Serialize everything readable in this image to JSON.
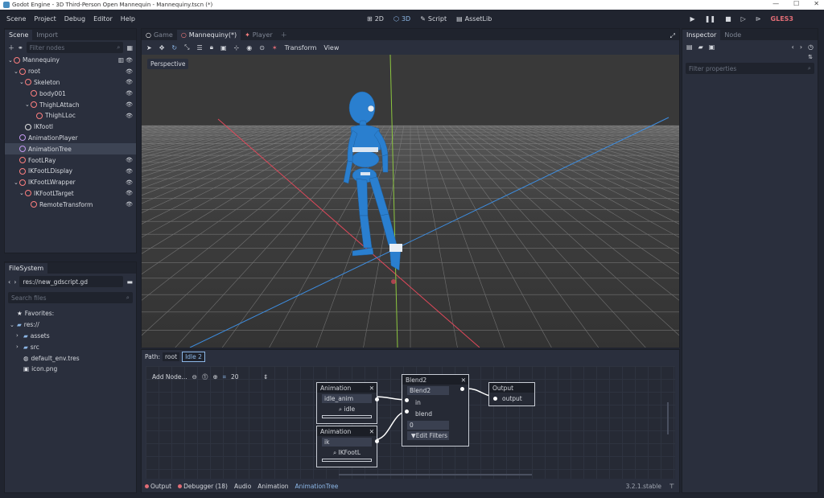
{
  "window_title": "Godot Engine - 3D Third-Person Open Mannequin - Mannequiny.tscn (*)",
  "menu": [
    "Scene",
    "Project",
    "Debug",
    "Editor",
    "Help"
  ],
  "workspaces": [
    {
      "label": "2D"
    },
    {
      "label": "3D"
    },
    {
      "label": "Script"
    },
    {
      "label": "AssetLib"
    }
  ],
  "renderer": "GLES3",
  "scene_dock": {
    "tabs": [
      "Scene",
      "Import"
    ],
    "filter_placeholder": "Filter nodes",
    "nodes": [
      {
        "label": "Mannequiny",
        "depth": 0,
        "color": "#fc7f7f",
        "eye": false,
        "script": true,
        "expand": "⌄"
      },
      {
        "label": "root",
        "depth": 1,
        "color": "#fc7f7f",
        "eye": true,
        "expand": "⌄"
      },
      {
        "label": "Skeleton",
        "depth": 2,
        "color": "#fc7f7f",
        "eye": true,
        "expand": "⌄"
      },
      {
        "label": "body001",
        "depth": 3,
        "color": "#fc7f7f",
        "eye": true,
        "expand": ""
      },
      {
        "label": "ThighLAttach",
        "depth": 3,
        "color": "#fc7f7f",
        "eye": true,
        "expand": "⌄"
      },
      {
        "label": "ThighLLoc",
        "depth": 4,
        "color": "#fc7f7f",
        "eye": true,
        "expand": ""
      },
      {
        "label": "IKfootl",
        "depth": 2,
        "color": "#e0e0e0",
        "eye": false,
        "expand": ""
      },
      {
        "label": "AnimationPlayer",
        "depth": 1,
        "color": "#c59bf2",
        "eye": false,
        "expand": ""
      },
      {
        "label": "AnimationTree",
        "depth": 1,
        "color": "#c59bf2",
        "eye": false,
        "expand": ""
      },
      {
        "label": "FootLRay",
        "depth": 1,
        "color": "#fc7f7f",
        "eye": true,
        "expand": ""
      },
      {
        "label": "IKFootLDisplay",
        "depth": 1,
        "color": "#fc7f7f",
        "eye": true,
        "expand": ""
      },
      {
        "label": "IKFootLWrapper",
        "depth": 1,
        "color": "#fc7f7f",
        "eye": true,
        "expand": "⌄"
      },
      {
        "label": "IKFootLTarget",
        "depth": 2,
        "color": "#fc7f7f",
        "eye": true,
        "expand": "⌄"
      },
      {
        "label": "RemoteTransform",
        "depth": 3,
        "color": "#fc7f7f",
        "eye": true,
        "expand": ""
      }
    ],
    "selected": 8
  },
  "filesystem": {
    "tab": "FileSystem",
    "path": "res://new_gdscript.gd",
    "search_placeholder": "Search files",
    "items": [
      {
        "label": "Favorites:",
        "depth": 0,
        "icon": "star-icon",
        "glyph": "★",
        "expand": ""
      },
      {
        "label": "res://",
        "depth": 0,
        "icon": "folder-icon",
        "glyph": "▰",
        "expand": "⌄"
      },
      {
        "label": "assets",
        "depth": 1,
        "icon": "folder-icon",
        "glyph": "▰",
        "expand": "›"
      },
      {
        "label": "src",
        "depth": 1,
        "icon": "folder-icon",
        "glyph": "▰",
        "expand": "›"
      },
      {
        "label": "default_env.tres",
        "depth": 1,
        "icon": "environment-icon",
        "glyph": "◍",
        "expand": ""
      },
      {
        "label": "icon.png",
        "depth": 1,
        "icon": "image-icon",
        "glyph": "▣",
        "expand": ""
      }
    ]
  },
  "editor_tabs": [
    {
      "label": "Game",
      "active": false
    },
    {
      "label": "Mannequiny(*)",
      "active": true
    },
    {
      "label": "Player",
      "active": false
    }
  ],
  "viewport": {
    "menu_transform": "Transform",
    "menu_view": "View",
    "perspective": "Perspective"
  },
  "animtree": {
    "path_label": "Path:",
    "path": [
      "root",
      "Idle 2"
    ],
    "add_node": "Add Node...",
    "zoom": "20",
    "nodes": {
      "anim1": {
        "title": "Animation",
        "value": "idle_anim",
        "button": "idle"
      },
      "anim2": {
        "title": "Animation",
        "value": "ik",
        "button": "IKFootL"
      },
      "blend": {
        "title": "Blend2",
        "value": "Blend2",
        "in": "in",
        "blend": "blend",
        "amount": "0",
        "filters": "Edit Filters"
      },
      "output": {
        "title": "Output",
        "port": "output"
      }
    }
  },
  "bottom_tabs": [
    "Output",
    "Debugger (18)",
    "Audio",
    "Animation",
    "AnimationTree"
  ],
  "version": "3.2.1.stable",
  "inspector": {
    "tabs": [
      "Inspector",
      "Node"
    ],
    "filter_placeholder": "Filter properties"
  }
}
